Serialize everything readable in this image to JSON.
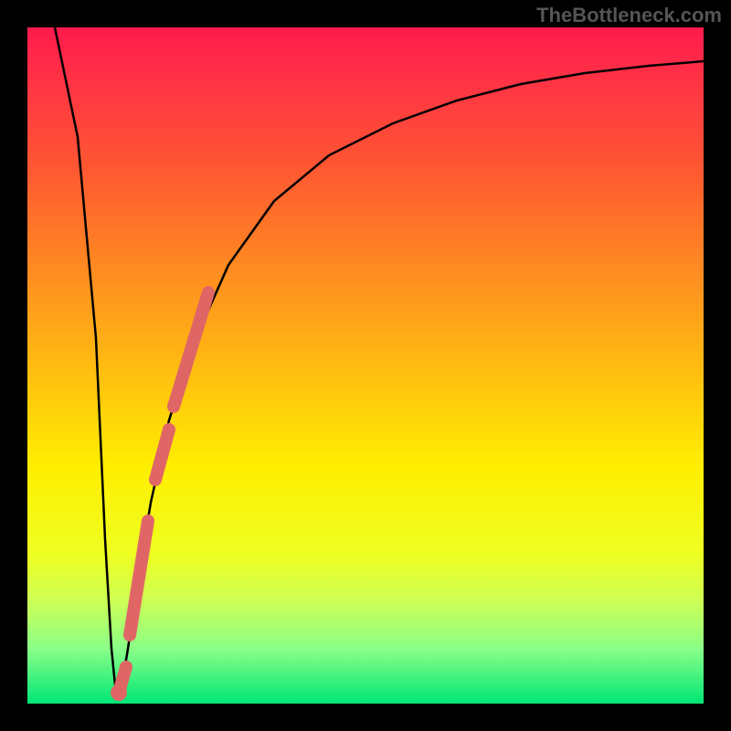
{
  "watermark": "TheBottleneck.com",
  "colors": {
    "bg": "#000000",
    "overlay": "#e06666",
    "curve": "#000000"
  },
  "chart_data": {
    "type": "line",
    "title": "",
    "xlabel": "",
    "ylabel": "",
    "xlim": [
      0,
      100
    ],
    "ylim": [
      0,
      100
    ],
    "series": [
      {
        "name": "bottleneck-curve",
        "x": [
          0,
          2,
          4,
          6,
          8,
          10,
          11,
          12,
          13,
          14,
          16,
          18,
          20,
          25,
          30,
          35,
          40,
          45,
          50,
          55,
          60,
          65,
          70,
          75,
          80,
          85,
          90,
          95,
          100
        ],
        "y": [
          100,
          82,
          64,
          46,
          28,
          10,
          3,
          0,
          5,
          12,
          26,
          38,
          48,
          64,
          74,
          80,
          84,
          87,
          89.5,
          91,
          92.2,
          93.2,
          94,
          94.6,
          95.1,
          95.5,
          95.8,
          96,
          96.2
        ]
      }
    ],
    "highlighted_segments": [
      {
        "x": [
          19.5,
          24.5
        ],
        "y": [
          45,
          62
        ]
      },
      {
        "x": [
          16.5,
          18.5
        ],
        "y": [
          32,
          41
        ]
      },
      {
        "x": [
          13.0,
          15.5
        ],
        "y": [
          6,
          24
        ]
      },
      {
        "x": [
          11.5,
          12.5
        ],
        "y": [
          0.5,
          3
        ]
      }
    ]
  }
}
